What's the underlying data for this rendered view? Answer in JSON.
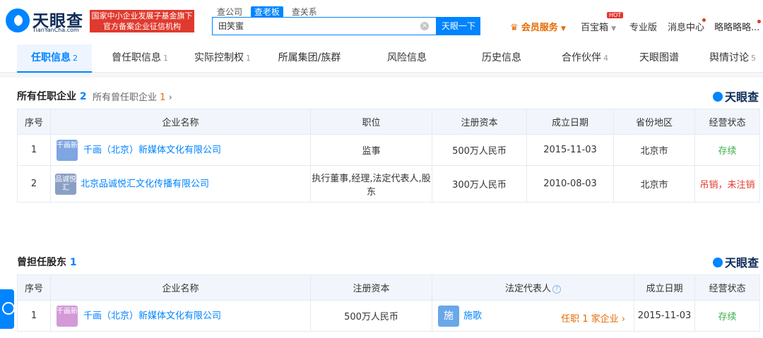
{
  "brand": {
    "name": "天眼查",
    "site": "TianYanCha.com",
    "badge_line1": "国家中小企业发展子基金旗下",
    "badge_line2": "官方备案企业征信机构"
  },
  "search": {
    "tabs": [
      "查公司",
      "查老板",
      "查关系"
    ],
    "active_tab": 1,
    "value": "田笑蜜",
    "button": "天眼一下"
  },
  "topnav": {
    "vip": "会员服务",
    "baibao": "百宝箱",
    "hot": "HOT",
    "pro": "专业版",
    "msg": "消息中心",
    "user": "略略略略..."
  },
  "tabs": [
    {
      "label": "任职信息",
      "count": "2"
    },
    {
      "label": "曾任职信息",
      "count": "1"
    },
    {
      "label": "实际控制权",
      "count": "1"
    },
    {
      "label": "所属集团/族群",
      "count": ""
    },
    {
      "label": "风险信息",
      "count": ""
    },
    {
      "label": "历史信息",
      "count": ""
    },
    {
      "label": "合作伙伴",
      "count": "4"
    },
    {
      "label": "天眼图谱",
      "count": ""
    },
    {
      "label": "舆情讨论",
      "count": "5"
    }
  ],
  "section1": {
    "title": "所有任职企业",
    "count": "2",
    "sub": "所有曾任职企业",
    "sub_count": "1",
    "headers": [
      "序号",
      "企业名称",
      "职位",
      "注册资本",
      "成立日期",
      "省份地区",
      "经营状态"
    ],
    "rows": [
      {
        "no": "1",
        "logo": "千画新",
        "name": "千画（北京）新媒体文化有限公司",
        "position": "监事",
        "capital": "500万人民币",
        "date": "2015-11-03",
        "region": "北京市",
        "status": "存续"
      },
      {
        "no": "2",
        "logo": "品诚悦汇",
        "name": "北京品诚悦汇文化传播有限公司",
        "position": "执行董事,经理,法定代表人,股东",
        "capital": "300万人民币",
        "date": "2010-08-03",
        "region": "北京市",
        "status": "吊销，未注销"
      }
    ]
  },
  "section2": {
    "title": "曾担任股东",
    "count": "1",
    "headers": [
      "序号",
      "企业名称",
      "注册资本",
      "法定代表人",
      "成立日期",
      "经营状态"
    ],
    "rows": [
      {
        "no": "1",
        "logo": "千画新",
        "name": "千画（北京）新媒体文化有限公司",
        "capital": "500万人民币",
        "rep": "施歌",
        "rep_avatar": "施",
        "rep_link": "任职 1 家企业",
        "date": "2015-11-03",
        "status": "存续"
      }
    ]
  },
  "colors": {
    "accent": "#0084ff",
    "ok": "#3bb04b",
    "bad": "#e03a2e",
    "vip": "#e66a00"
  }
}
